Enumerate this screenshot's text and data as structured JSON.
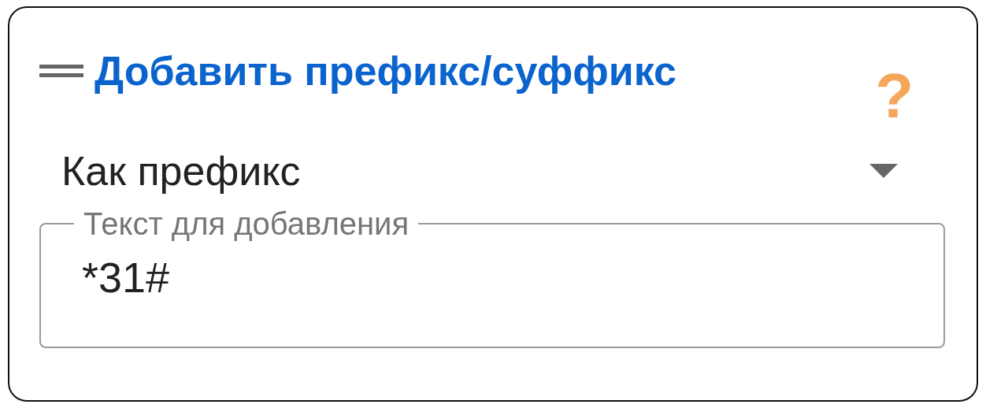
{
  "header": {
    "title": "Добавить префикс/суффикс",
    "help": "?"
  },
  "mode_select": {
    "value": "Как префикс"
  },
  "text_field": {
    "label": "Текст для добавления",
    "value": "*31#"
  }
}
